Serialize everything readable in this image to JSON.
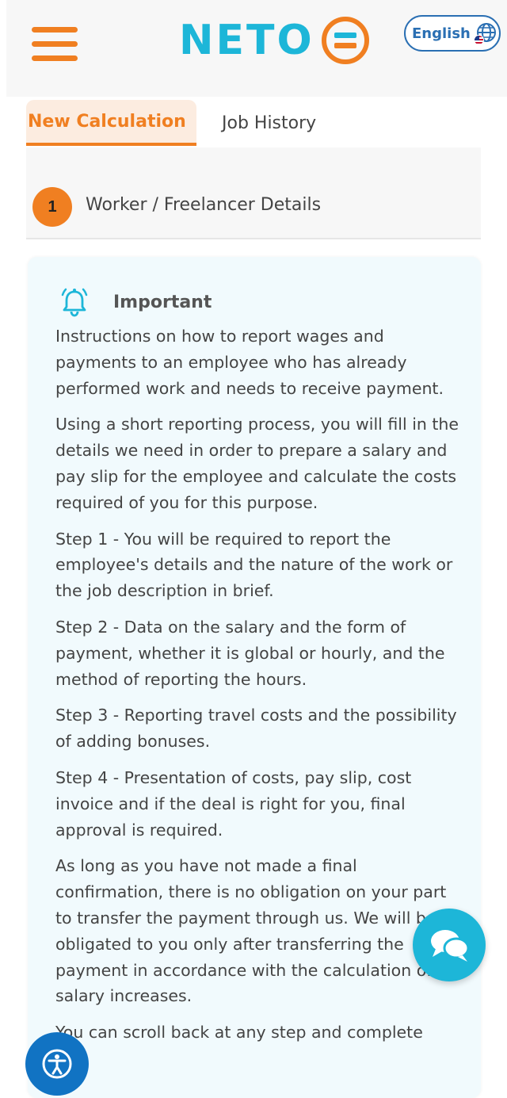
{
  "header": {
    "logo_text": "NETO",
    "language_label": "English"
  },
  "tabs": [
    {
      "label": "New Calculation",
      "active": true
    },
    {
      "label": "Job History",
      "active": false
    }
  ],
  "step": {
    "number": "1",
    "label": "Worker / Freelancer Details"
  },
  "info": {
    "title": "Important",
    "paragraphs": [
      "Instructions on how to report wages and payments to an employee who has already performed work and needs to receive payment.",
      "Using a short reporting process, you will fill in the details we need in order to prepare a salary and pay slip for the employee and calculate the costs required of you for this purpose.",
      "Step 1 - You will be required to report the employee's details and the nature of the work or the job description in brief.",
      "Step 2 - Data on the salary and the form of payment, whether it is global or hourly, and the method of reporting the hours.",
      "Step 3 - Reporting travel costs and the possibility of adding bonuses.",
      "Step 4 - Presentation of costs, pay slip, cost invoice and if the deal is right for you, final approval is required.",
      "As long as you have not made a final confirmation, there is no obligation on your part to transfer the payment through us. We will be obligated to you only after transferring the payment in accordance with the calculation of the salary increases.",
      "You can scroll back at any step and complete"
    ]
  },
  "colors": {
    "brand_orange": "#f07f21",
    "brand_cyan": "#1db6d8",
    "accessibility_blue": "#1173c3"
  }
}
